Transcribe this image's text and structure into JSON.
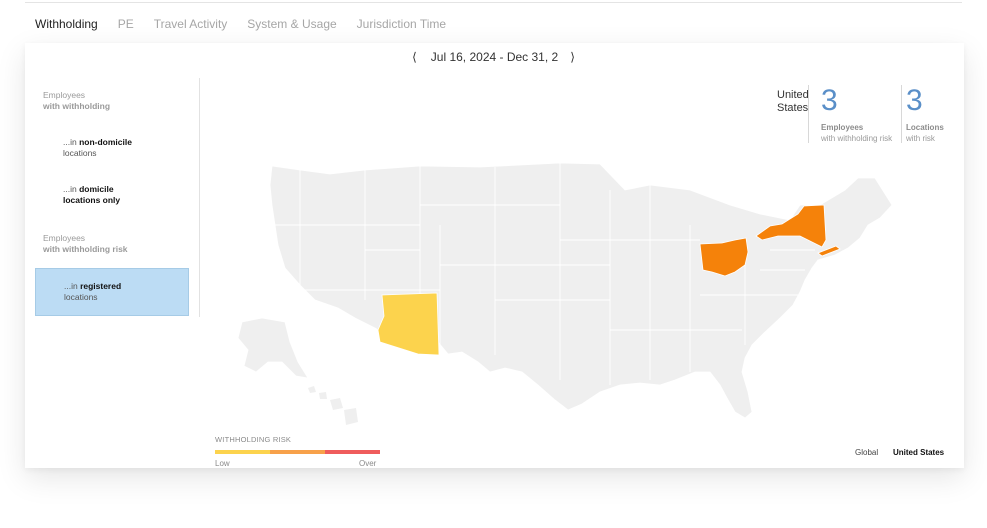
{
  "tabs": [
    {
      "label": "Withholding",
      "active": true
    },
    {
      "label": "PE",
      "active": false
    },
    {
      "label": "Travel Activity",
      "active": false
    },
    {
      "label": "System & Usage",
      "active": false
    },
    {
      "label": "Jurisdiction Time",
      "active": false
    }
  ],
  "date_nav": {
    "prev_glyph": "⟨",
    "range": "Jul 16, 2024 - Dec 31, 2",
    "next_glyph": "⟩"
  },
  "sidebar": {
    "group1": {
      "line1": "Employees",
      "line2": "with withholding"
    },
    "item1": {
      "prefix": "...in ",
      "bold": "non-domicile",
      "line2": "locations"
    },
    "item2": {
      "prefix": "...in ",
      "bold": "domicile",
      "line2": "locations only"
    },
    "group2": {
      "line1": "Employees",
      "line2": "with withholding risk"
    },
    "item3": {
      "prefix": "...in ",
      "bold": "registered",
      "line2": "locations",
      "selected": true
    }
  },
  "stats": {
    "region_line1": "United",
    "region_line2": "States",
    "employees_value": "3",
    "employees_label_bold": "Employees",
    "employees_label": "with withholding risk",
    "locations_value": "3",
    "locations_label_bold": "Locations",
    "locations_label": "with risk"
  },
  "map": {
    "highlighted_states": [
      {
        "state": "Arizona",
        "risk": "low",
        "color": "#fcd34d"
      },
      {
        "state": "Ohio",
        "risk": "medium",
        "color": "#f5820a"
      },
      {
        "state": "New York",
        "risk": "medium",
        "color": "#f5820a"
      }
    ],
    "base_color": "#efefef"
  },
  "legend": {
    "title": "WITHHOLDING RISK",
    "low": "Low",
    "over": "Over",
    "colors": [
      "#fcd34d",
      "#f7a14a",
      "#ef5c5c"
    ]
  },
  "scope": {
    "global": "Global",
    "us": "United States"
  }
}
